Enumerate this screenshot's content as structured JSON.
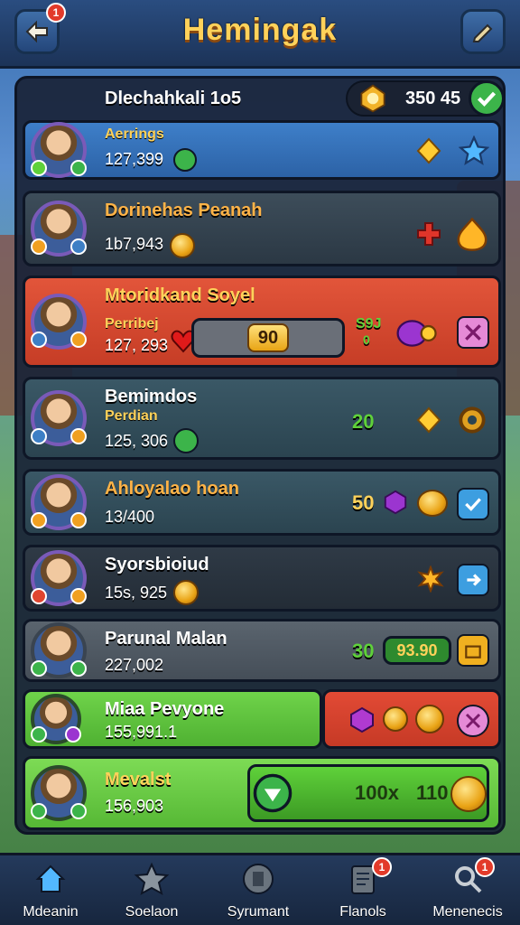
{
  "header": {
    "title": "Hemingak",
    "back_badge": "1"
  },
  "resource": {
    "value": "350 45"
  },
  "rows": [
    {
      "name": "Dlechahkali 1o5",
      "sub": "Aerrings",
      "score": "127,399"
    },
    {
      "name": "Dorinehas Peanah",
      "sub": "",
      "score": "1b7,943"
    },
    {
      "name": "Mtoridkand Soyel",
      "sub": "Perribej",
      "score": "127, 293",
      "bar_value": "90",
      "mini_top": "S9J",
      "mini_bottom": "0"
    },
    {
      "name": "Bemimdos",
      "sub": "Perdian",
      "score": "125, 306",
      "num": "20"
    },
    {
      "name": "Ahloyalao hoan",
      "sub": "",
      "score": "13/400",
      "num": "50"
    },
    {
      "name": "Syorsbioiud",
      "sub": "",
      "score": "15s, 925"
    },
    {
      "name": "Parunal Malan",
      "sub": "",
      "score": "227,002",
      "num": "30",
      "pill": "93.90"
    },
    {
      "name": "Miaa Pevyone",
      "sub": "",
      "score": "155,991.1"
    },
    {
      "name": "Mevalst",
      "sub": "",
      "score": "156,903",
      "num": "100x",
      "num2": "110"
    }
  ],
  "nav": [
    {
      "label": "Mdeanin",
      "icon": "home-icon"
    },
    {
      "label": "Soelaon",
      "icon": "star-icon"
    },
    {
      "label": "Syrumant",
      "icon": "shield-icon"
    },
    {
      "label": "Flanols",
      "icon": "list-icon",
      "badge": "1"
    },
    {
      "label": "Menenecis",
      "icon": "search-icon",
      "badge": "1"
    }
  ],
  "colors": {
    "gold": "#ffd25a",
    "green": "#5fd13a",
    "red": "#e0452f",
    "blue": "#3d7fc5"
  }
}
